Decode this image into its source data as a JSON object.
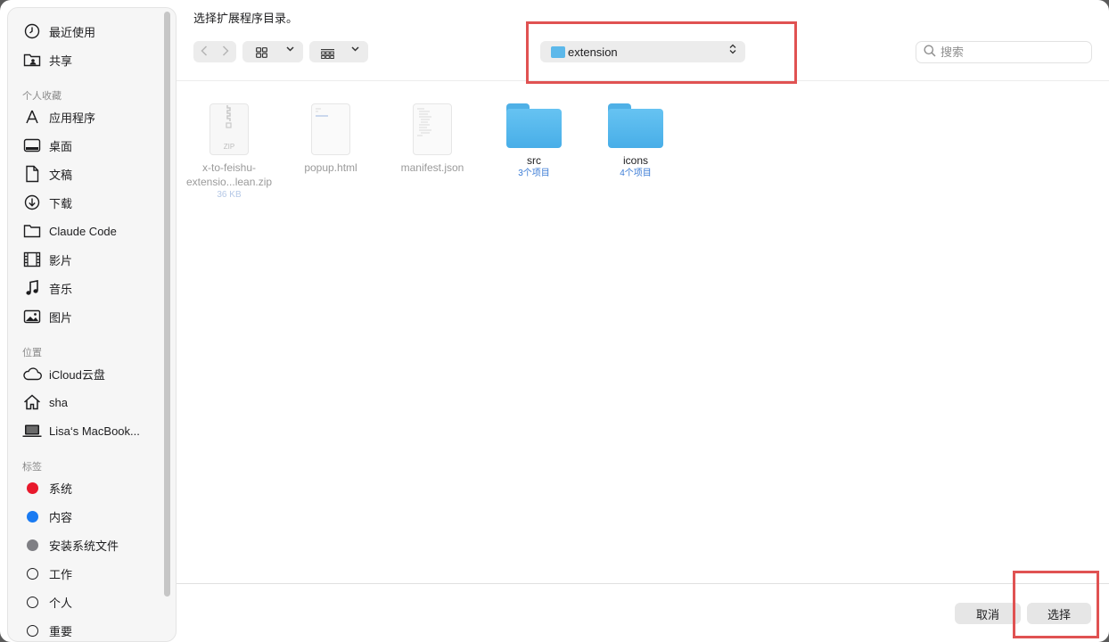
{
  "title": "选择扩展程序目录。",
  "sidebar": {
    "favorites": [
      {
        "label": "最近使用",
        "icon": "clock-icon"
      },
      {
        "label": "共享",
        "icon": "shared-folder-icon"
      }
    ],
    "personal_header": "个人收藏",
    "personal": [
      {
        "label": "应用程序",
        "icon": "applications-icon"
      },
      {
        "label": "桌面",
        "icon": "desktop-icon"
      },
      {
        "label": "文稿",
        "icon": "document-icon"
      },
      {
        "label": "下载",
        "icon": "download-icon"
      },
      {
        "label": "Claude Code",
        "icon": "folder-icon"
      },
      {
        "label": "影片",
        "icon": "film-icon"
      },
      {
        "label": "音乐",
        "icon": "music-icon"
      },
      {
        "label": "图片",
        "icon": "photo-icon"
      }
    ],
    "locations_header": "位置",
    "locations": [
      {
        "label": "iCloud云盘",
        "icon": "cloud-icon"
      },
      {
        "label": "sha",
        "icon": "home-icon"
      },
      {
        "label": "Lisa‘s MacBook...",
        "icon": "laptop-icon"
      }
    ],
    "tags_header": "标签",
    "tags": [
      {
        "label": "系统",
        "color": "#e8192c"
      },
      {
        "label": "内容",
        "color": "#1a7bf2"
      },
      {
        "label": "安装系统文件",
        "color": "#7f7f84"
      },
      {
        "label": "工作",
        "color": ""
      },
      {
        "label": "个人",
        "color": ""
      },
      {
        "label": "重要",
        "color": ""
      }
    ]
  },
  "toolbar": {
    "path": "extension",
    "search_placeholder": "搜索"
  },
  "files": [
    {
      "name1": "x-to-feishu-",
      "name2": "extensio...lean.zip",
      "meta": "36 KB",
      "type": "zip"
    },
    {
      "name1": "popup.html",
      "name2": "",
      "meta": "",
      "type": "html"
    },
    {
      "name1": "manifest.json",
      "name2": "",
      "meta": "",
      "type": "json"
    },
    {
      "name1": "src",
      "name2": "",
      "meta": "3个项目",
      "type": "folder"
    },
    {
      "name1": "icons",
      "name2": "",
      "meta": "4个项目",
      "type": "folder"
    }
  ],
  "zip_label": "ZIP",
  "buttons": {
    "cancel": "取消",
    "choose": "选择"
  }
}
